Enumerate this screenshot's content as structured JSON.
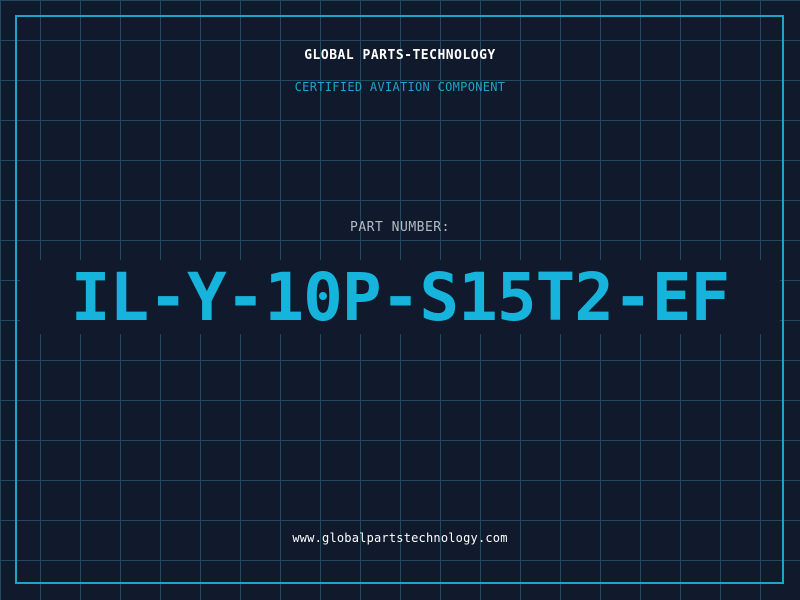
{
  "header": {
    "company": "GLOBAL PARTS-TECHNOLOGY",
    "tagline": "CERTIFIED AVIATION COMPONENT"
  },
  "part": {
    "label": "PART NUMBER:",
    "number": "IL-Y-10P-S15T2-EF"
  },
  "footer": {
    "website": "www.globalpartstechnology.com"
  },
  "colors": {
    "background": "#101a2c",
    "grid": "#1f4a60",
    "accent": "#1ea3c9",
    "part_number": "#16b4dc",
    "text": "#ffffff"
  }
}
